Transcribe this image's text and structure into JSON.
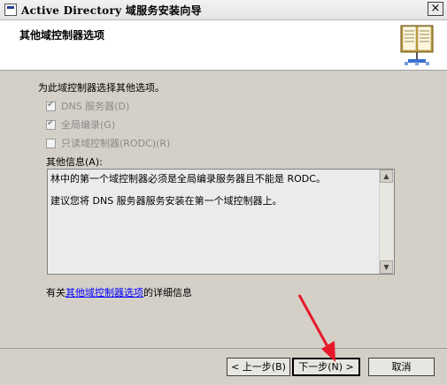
{
  "window": {
    "title": "Active Directory 域服务安装向导",
    "close_label": "×"
  },
  "header": {
    "title": "其他域控制器选项",
    "icon": "book-icon"
  },
  "content": {
    "intro": "为此域控制器选择其他选项。",
    "options": [
      {
        "label": "DNS 服务器(D)",
        "checked": true,
        "enabled": false
      },
      {
        "label": "全局编录(G)",
        "checked": true,
        "enabled": false
      },
      {
        "label": "只读域控制器(RODC)(R)",
        "checked": false,
        "enabled": false
      }
    ],
    "other_info_label": "其他信息(A):",
    "other_info_lines": [
      "林中的第一个域控制器必须是全局编录服务器且不能是 RODC。",
      "建议您将 DNS 服务器服务安装在第一个域控制器上。"
    ],
    "more_info_prefix": "有关",
    "more_info_link": "其他域控制器选项",
    "more_info_suffix": "的详细信息"
  },
  "buttons": {
    "back": "< 上一步(B)",
    "next": "下一步(N) >",
    "cancel": "取消"
  },
  "colors": {
    "arrow": "#e8182b",
    "link": "#0000ff"
  }
}
